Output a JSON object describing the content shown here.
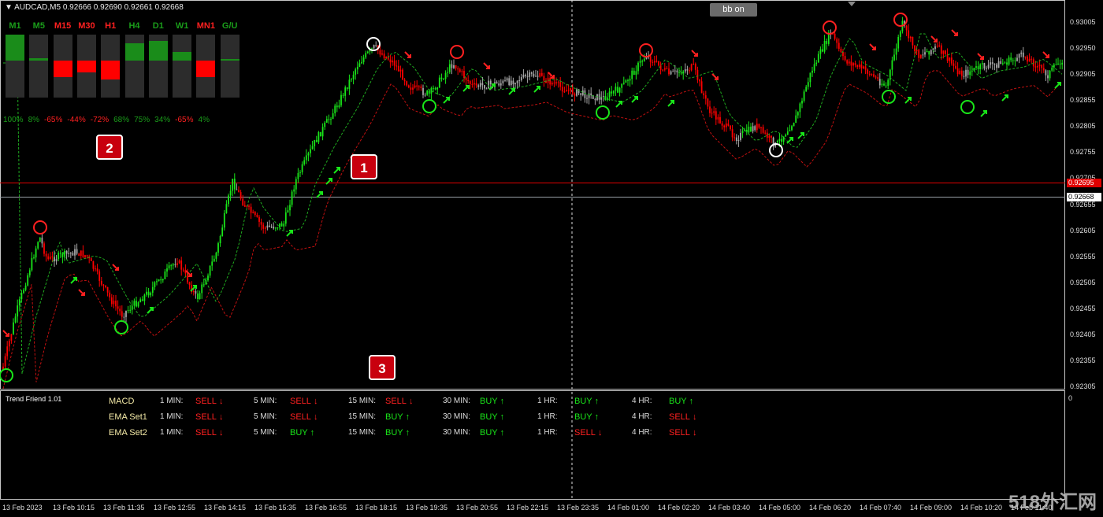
{
  "header": {
    "symbol": "AUDCAD,M5",
    "ohlc": "0.92666 0.92690 0.92661 0.92668",
    "bb_button": "bb on"
  },
  "strength_panel": {
    "timeframes": [
      {
        "label": "M1",
        "pct": "100%",
        "dir": "up",
        "strength": 1.0
      },
      {
        "label": "M5",
        "pct": "8%",
        "dir": "up",
        "strength": 0.08
      },
      {
        "label": "M15",
        "pct": "-65%",
        "dir": "down",
        "strength": 0.65
      },
      {
        "label": "M30",
        "pct": "-44%",
        "dir": "down",
        "strength": 0.44
      },
      {
        "label": "H1",
        "pct": "-72%",
        "dir": "down",
        "strength": 0.72
      },
      {
        "label": "H4",
        "pct": "68%",
        "dir": "up",
        "strength": 0.68
      },
      {
        "label": "D1",
        "pct": "75%",
        "dir": "up",
        "strength": 0.75
      },
      {
        "label": "W1",
        "pct": "34%",
        "dir": "up",
        "strength": 0.34
      },
      {
        "label": "MN1",
        "pct": "-65%",
        "dir": "down",
        "strength": 0.65
      },
      {
        "label": "G/U",
        "pct": "4%",
        "dir": "up",
        "strength": 0.04
      }
    ]
  },
  "badges": {
    "one": "1",
    "two": "2",
    "three": "3"
  },
  "price_axis": {
    "ticks": [
      "0.93005",
      "0.92950",
      "0.92905",
      "0.92855",
      "0.92805",
      "0.92755",
      "0.92705",
      "0.92655",
      "0.92605",
      "0.92555",
      "0.92505",
      "0.92455",
      "0.92405",
      "0.92355",
      "0.92305"
    ],
    "red_line_tag": "0.92695",
    "current_tag": "0.92668"
  },
  "indicator": {
    "title": "Trend Friend 1.01",
    "zero_label": "0",
    "rows": [
      {
        "name": "MACD",
        "cells": [
          {
            "tf": "1 MIN:",
            "sig": "SELL",
            "arrow": "🡓",
            "dir": "sell"
          },
          {
            "tf": "5 MIN:",
            "sig": "SELL",
            "arrow": "🡓",
            "dir": "sell"
          },
          {
            "tf": "15 MIN:",
            "sig": "SELL",
            "arrow": "🡓",
            "dir": "sell"
          },
          {
            "tf": "30 MIN:",
            "sig": "BUY",
            "arrow": "🡑",
            "dir": "buy"
          },
          {
            "tf": "1 HR:",
            "sig": "BUY",
            "arrow": "🡑",
            "dir": "buy"
          },
          {
            "tf": "4 HR:",
            "sig": "BUY",
            "arrow": "🡑",
            "dir": "buy"
          }
        ]
      },
      {
        "name": "EMA Set1",
        "cells": [
          {
            "tf": "1 MIN:",
            "sig": "SELL",
            "arrow": "🡓",
            "dir": "sell"
          },
          {
            "tf": "5 MIN:",
            "sig": "SELL",
            "arrow": "🡓",
            "dir": "sell"
          },
          {
            "tf": "15 MIN:",
            "sig": "BUY",
            "arrow": "🡑",
            "dir": "buy"
          },
          {
            "tf": "30 MIN:",
            "sig": "BUY",
            "arrow": "🡑",
            "dir": "buy"
          },
          {
            "tf": "1 HR:",
            "sig": "BUY",
            "arrow": "🡑",
            "dir": "buy"
          },
          {
            "tf": "4 HR:",
            "sig": "SELL",
            "arrow": "🡓",
            "dir": "sell"
          }
        ]
      },
      {
        "name": "EMA Set2",
        "cells": [
          {
            "tf": "1 MIN:",
            "sig": "SELL",
            "arrow": "🡓",
            "dir": "sell"
          },
          {
            "tf": "5 MIN:",
            "sig": "BUY",
            "arrow": "🡑",
            "dir": "buy"
          },
          {
            "tf": "15 MIN:",
            "sig": "BUY",
            "arrow": "🡑",
            "dir": "buy"
          },
          {
            "tf": "30 MIN:",
            "sig": "BUY",
            "arrow": "🡑",
            "dir": "buy"
          },
          {
            "tf": "1 HR:",
            "sig": "SELL",
            "arrow": "🡓",
            "dir": "sell"
          },
          {
            "tf": "4 HR:",
            "sig": "SELL",
            "arrow": "🡓",
            "dir": "sell"
          }
        ]
      }
    ]
  },
  "time_axis": {
    "ticks": [
      "13 Feb 2023",
      "13 Feb 10:15",
      "13 Feb 11:35",
      "13 Feb 12:55",
      "13 Feb 14:15",
      "13 Feb 15:35",
      "13 Feb 16:55",
      "13 Feb 18:15",
      "13 Feb 19:35",
      "13 Feb 20:55",
      "13 Feb 22:15",
      "13 Feb 23:35",
      "14 Feb 01:00",
      "14 Feb 02:20",
      "14 Feb 03:40",
      "14 Feb 05:00",
      "14 Feb 06:20",
      "14 Feb 07:40",
      "14 Feb 09:00",
      "14 Feb 10:20",
      "14 Feb 11:40"
    ]
  },
  "watermark": "518外汇网",
  "colors": {
    "bull": "#19e619",
    "bear": "#ff0000",
    "neutral": "#a8a8a8",
    "signal_red_line": "#e00000",
    "current_price_line": "#9aa0a6"
  }
}
